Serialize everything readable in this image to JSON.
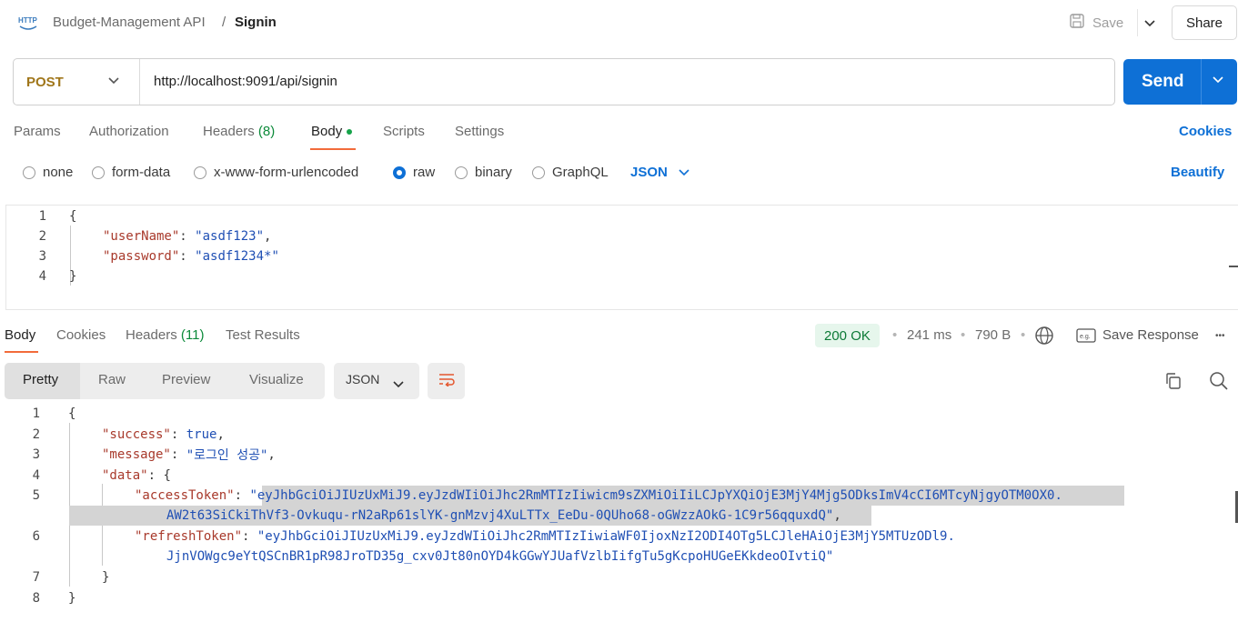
{
  "header": {
    "icon": "http-request-icon",
    "collection": "Budget-Management API",
    "separator": "/",
    "request_name": "Signin",
    "save_label": "Save",
    "share_label": "Share"
  },
  "request": {
    "method": "POST",
    "url": "http://localhost:9091/api/signin",
    "send_label": "Send"
  },
  "request_tabs": {
    "params": "Params",
    "authorization": "Authorization",
    "headers": "Headers",
    "headers_count": "(8)",
    "body": "Body",
    "scripts": "Scripts",
    "settings": "Settings",
    "cookies": "Cookies"
  },
  "body_types": {
    "none": "none",
    "form_data": "form-data",
    "urlencoded": "x-www-form-urlencoded",
    "raw": "raw",
    "binary": "binary",
    "graphql": "GraphQL",
    "selected": "raw",
    "language": "JSON",
    "beautify": "Beautify"
  },
  "request_body_lines": [
    {
      "n": "1",
      "t": "{"
    },
    {
      "n": "2",
      "k": "\"userName\"",
      "v": "\"asdf123\"",
      "end": ","
    },
    {
      "n": "3",
      "k": "\"password\"",
      "v": "\"asdf1234*\"",
      "end": ""
    },
    {
      "n": "4",
      "t": "}"
    }
  ],
  "response_tabs": {
    "body": "Body",
    "cookies": "Cookies",
    "headers": "Headers",
    "headers_count": "(11)",
    "test_results": "Test Results"
  },
  "response_meta": {
    "status": "200 OK",
    "time": "241 ms",
    "size": "790 B",
    "save_response": "Save Response",
    "dot": "•",
    "more": "•••",
    "status_color": "#0c7a36"
  },
  "view_tabs": {
    "pretty": "Pretty",
    "raw": "Raw",
    "preview": "Preview",
    "visualize": "Visualize",
    "format": "JSON"
  },
  "response_body": {
    "l1_n": "1",
    "l1": "{",
    "l2_n": "2",
    "l2_k": "\"success\"",
    "l2_v": "true",
    "l3_n": "3",
    "l3_k": "\"message\"",
    "l3_v": "\"로그인 성공\"",
    "l4_n": "4",
    "l4_k": "\"data\"",
    "l4_v": "{",
    "l5_n": "5",
    "l5_k": "\"accessToken\"",
    "l5_v": "\"eyJhbGciOiJIUzUxMiJ9.eyJzdWIiOiJhc2RmMTIzIiwicm9sZXMiOiIiLCJpYXQiOjE3MjY4Mjg5ODksImV4cCI6MTcyNjgyOTM0OX0.",
    "l5b_v": "AW2t63SiCkiThVf3-Ovkuqu-rN2aRp61slYK-gnMzvj4XuLTTx_EeDu-0QUho68-oGWzzAOkG-1C9r56qquxdQ\"",
    "l6_n": "6",
    "l6_k": "\"refreshToken\"",
    "l6_v": "\"eyJhbGciOiJIUzUxMiJ9.eyJzdWIiOiJhc2RmMTIzIiwiaWF0IjoxNzI2ODI4OTg5LCJleHAiOjE3MjY5MTUzODl9.",
    "l6b_v": "JjnVOWgc9eYtQSCnBR1pR98JroTD35g_cxv0Jt80nOYD4kGGwYJUafVzlbIifgTu5gKcpoHUGeEKkdeoOIvtiQ\"",
    "l7_n": "7",
    "l7": "}",
    "l8_n": "8",
    "l8": "}"
  }
}
